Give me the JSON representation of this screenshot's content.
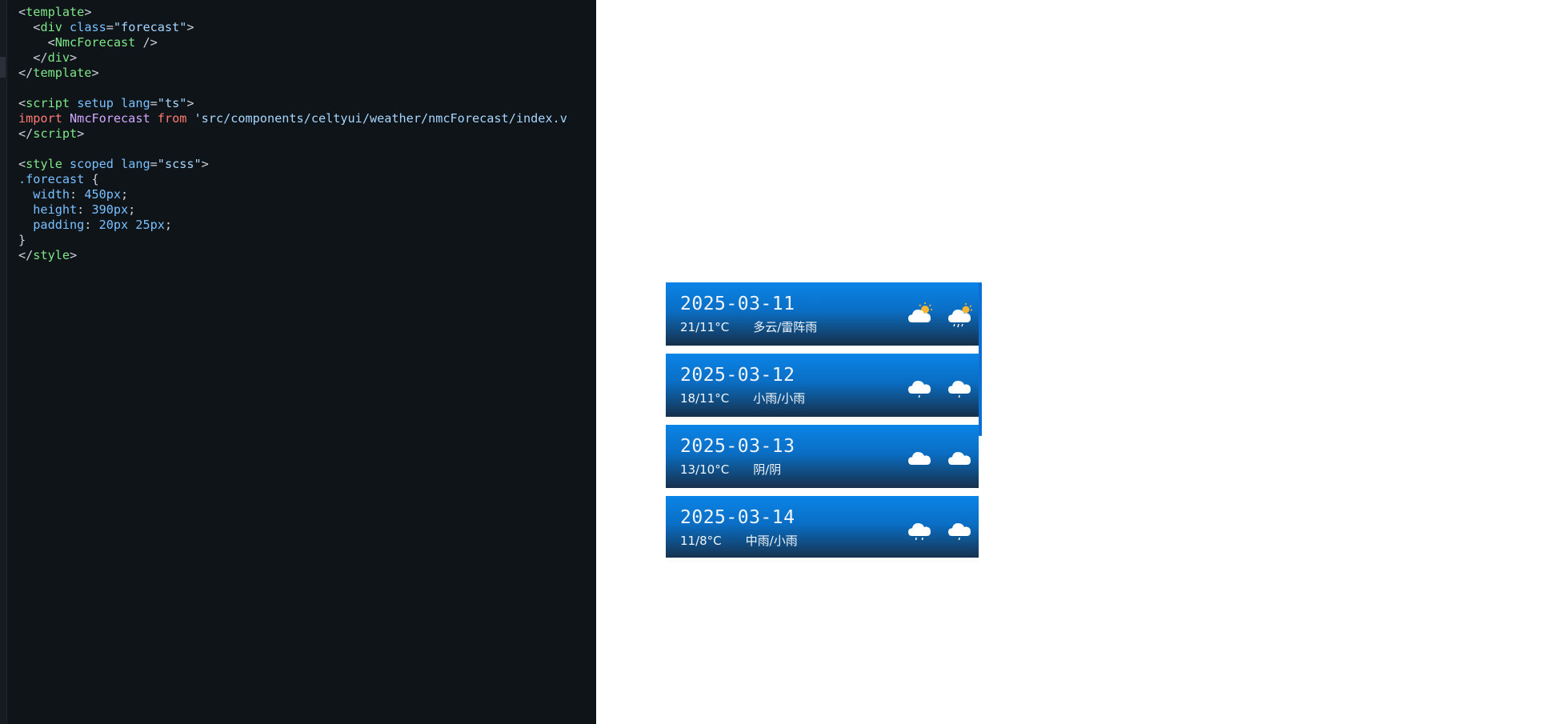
{
  "editor": {
    "lines": [
      [
        {
          "t": "<",
          "c": "pun"
        },
        {
          "t": "template",
          "c": "tag"
        },
        {
          "t": ">",
          "c": "pun"
        }
      ],
      [
        {
          "t": "  <",
          "c": "pun"
        },
        {
          "t": "div",
          "c": "tag"
        },
        {
          "t": " ",
          "c": "pun"
        },
        {
          "t": "class",
          "c": "attr"
        },
        {
          "t": "=",
          "c": "pun"
        },
        {
          "t": "\"forecast\"",
          "c": "str"
        },
        {
          "t": ">",
          "c": "pun"
        }
      ],
      [
        {
          "t": "    <",
          "c": "pun"
        },
        {
          "t": "NmcForecast",
          "c": "tag"
        },
        {
          "t": " />",
          "c": "pun"
        }
      ],
      [
        {
          "t": "  </",
          "c": "pun"
        },
        {
          "t": "div",
          "c": "tag"
        },
        {
          "t": ">",
          "c": "pun"
        }
      ],
      [
        {
          "t": "</",
          "c": "pun"
        },
        {
          "t": "template",
          "c": "tag"
        },
        {
          "t": ">",
          "c": "pun"
        }
      ],
      [],
      [
        {
          "t": "<",
          "c": "pun"
        },
        {
          "t": "script",
          "c": "tag"
        },
        {
          "t": " ",
          "c": "pun"
        },
        {
          "t": "setup",
          "c": "attr"
        },
        {
          "t": " ",
          "c": "pun"
        },
        {
          "t": "lang",
          "c": "attr"
        },
        {
          "t": "=",
          "c": "pun"
        },
        {
          "t": "\"ts\"",
          "c": "str"
        },
        {
          "t": ">",
          "c": "pun"
        }
      ],
      [
        {
          "t": "import",
          "c": "kw"
        },
        {
          "t": " ",
          "c": "pun"
        },
        {
          "t": "NmcForecast",
          "c": "ident"
        },
        {
          "t": " ",
          "c": "pun"
        },
        {
          "t": "from",
          "c": "kw"
        },
        {
          "t": " ",
          "c": "pun"
        },
        {
          "t": "'src/components/celtyui/weather/nmcForecast/index.v",
          "c": "str"
        }
      ],
      [
        {
          "t": "</",
          "c": "pun"
        },
        {
          "t": "script",
          "c": "tag"
        },
        {
          "t": ">",
          "c": "pun"
        }
      ],
      [],
      [
        {
          "t": "<",
          "c": "pun"
        },
        {
          "t": "style",
          "c": "tag"
        },
        {
          "t": " ",
          "c": "pun"
        },
        {
          "t": "scoped",
          "c": "attr"
        },
        {
          "t": " ",
          "c": "pun"
        },
        {
          "t": "lang",
          "c": "attr"
        },
        {
          "t": "=",
          "c": "pun"
        },
        {
          "t": "\"scss\"",
          "c": "str"
        },
        {
          "t": ">",
          "c": "pun"
        }
      ],
      [
        {
          "t": ".forecast",
          "c": "sel"
        },
        {
          "t": " {",
          "c": "pun"
        }
      ],
      [
        {
          "t": "  width",
          "c": "prop"
        },
        {
          "t": ": ",
          "c": "pun"
        },
        {
          "t": "450px",
          "c": "num"
        },
        {
          "t": ";",
          "c": "pun"
        }
      ],
      [
        {
          "t": "  height",
          "c": "prop"
        },
        {
          "t": ": ",
          "c": "pun"
        },
        {
          "t": "390px",
          "c": "num"
        },
        {
          "t": ";",
          "c": "pun"
        }
      ],
      [
        {
          "t": "  padding",
          "c": "prop"
        },
        {
          "t": ": ",
          "c": "pun"
        },
        {
          "t": "20px 25px",
          "c": "num"
        },
        {
          "t": ";",
          "c": "pun"
        }
      ],
      [
        {
          "t": "}",
          "c": "pun"
        }
      ],
      [
        {
          "t": "</",
          "c": "pun"
        },
        {
          "t": "style",
          "c": "tag"
        },
        {
          "t": ">",
          "c": "pun"
        }
      ]
    ]
  },
  "forecast": {
    "days": [
      {
        "date": "2025-03-11",
        "temp": "21/11°C",
        "condition": "多云/雷阵雨",
        "icon_day": "partly-cloudy-day-icon",
        "icon_night": "thunder-shower-icon"
      },
      {
        "date": "2025-03-12",
        "temp": "18/11°C",
        "condition": "小雨/小雨",
        "icon_day": "light-rain-icon",
        "icon_night": "light-rain-icon"
      },
      {
        "date": "2025-03-13",
        "temp": "13/10°C",
        "condition": "阴/阴",
        "icon_day": "overcast-icon",
        "icon_night": "overcast-icon"
      },
      {
        "date": "2025-03-14",
        "temp": "11/8°C",
        "condition": "中雨/小雨",
        "icon_day": "moderate-rain-icon",
        "icon_night": "light-rain-icon"
      }
    ]
  },
  "colors": {
    "editor_bg": "#0f1419",
    "card_top": "#0a84e8",
    "card_bottom": "#16304a",
    "scrollbar": "#0d6fd1"
  }
}
